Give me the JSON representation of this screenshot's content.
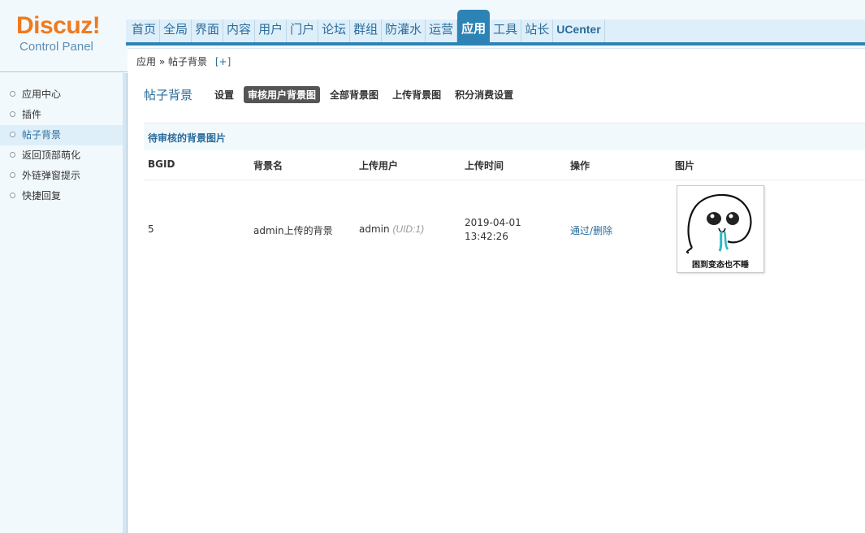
{
  "logo": {
    "main": "Discuz!",
    "sub": "Control Panel"
  },
  "nav": {
    "items": [
      "首页",
      "全局",
      "界面",
      "内容",
      "用户",
      "门户",
      "论坛",
      "群组",
      "防灌水",
      "运营",
      "应用",
      "工具",
      "站长",
      "UCenter"
    ],
    "active": "应用"
  },
  "breadcrumb": {
    "parent": "应用",
    "separator": "»",
    "current": "帖子背景",
    "add": "[+]"
  },
  "sidebar": {
    "items": [
      {
        "label": "应用中心"
      },
      {
        "label": "插件"
      },
      {
        "label": "帖子背景"
      },
      {
        "label": "返回顶部萌化"
      },
      {
        "label": "外链弹窗提示"
      },
      {
        "label": "快捷回复"
      }
    ],
    "active": "帖子背景"
  },
  "main": {
    "title": "帖子背景",
    "tabs": [
      "设置",
      "审核用户背景图",
      "全部背景图",
      "上传背景图",
      "积分消费设置"
    ],
    "active_tab": "审核用户背景图",
    "section_title": "待审核的背景图片",
    "columns": [
      "BGID",
      "背景名",
      "上传用户",
      "上传时间",
      "操作",
      "图片"
    ],
    "rows": [
      {
        "bgid": "5",
        "name": "admin上传的背景",
        "user": "admin",
        "uid": "(UID:1)",
        "date": "2019-04-01",
        "time": "13:42:26",
        "approve": "通过",
        "sep": "/",
        "delete": "删除",
        "image_caption": "困到变态也不睡"
      }
    ]
  },
  "colors": {
    "brand": "#f07a1d",
    "accent": "#2d83b6",
    "link": "#2b6c9a",
    "active_tab_bg": "#555555"
  }
}
